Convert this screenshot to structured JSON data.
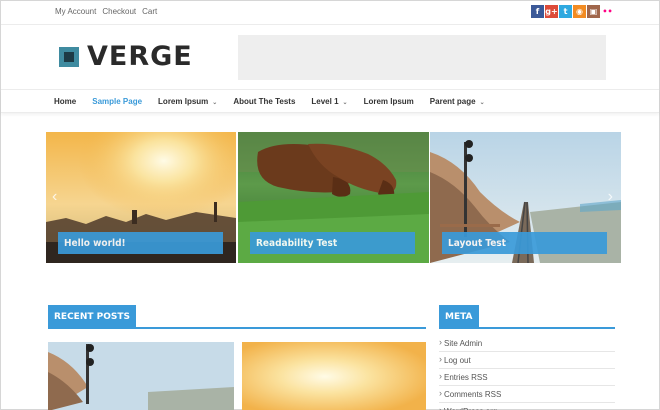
{
  "topbar": {
    "links": [
      "My Account",
      "Checkout",
      "Cart"
    ],
    "social": [
      {
        "name": "facebook-icon",
        "glyph": "f",
        "color": "#3b5998"
      },
      {
        "name": "googleplus-icon",
        "glyph": "g+",
        "color": "#dd4b39"
      },
      {
        "name": "twitter-icon",
        "glyph": "t",
        "color": "#2fa9e0"
      },
      {
        "name": "rss-icon",
        "glyph": "◉",
        "color": "#f28b22"
      },
      {
        "name": "instagram-icon",
        "glyph": "▣",
        "color": "#a0664b"
      },
      {
        "name": "flickr-icon",
        "glyph": "••",
        "color": "#ffffff"
      }
    ]
  },
  "logo": {
    "text": "VERGE"
  },
  "nav": {
    "items": [
      {
        "label": "Home",
        "active": false,
        "dropdown": false
      },
      {
        "label": "Sample Page",
        "active": true,
        "dropdown": false
      },
      {
        "label": "Lorem Ipsum",
        "active": false,
        "dropdown": true
      },
      {
        "label": "About The Tests",
        "active": false,
        "dropdown": false
      },
      {
        "label": "Level 1",
        "active": false,
        "dropdown": true
      },
      {
        "label": "Lorem Ipsum",
        "active": false,
        "dropdown": false
      },
      {
        "label": "Parent page",
        "active": false,
        "dropdown": true
      }
    ]
  },
  "slider": {
    "slides": [
      {
        "caption": "Hello world!",
        "scene": "sunset"
      },
      {
        "caption": "Readability Test",
        "scene": "dogs"
      },
      {
        "caption": "Layout Test",
        "scene": "railway"
      }
    ]
  },
  "recent_posts": {
    "title": "RECENT POSTS"
  },
  "meta": {
    "title": "META",
    "items": [
      "Site Admin",
      "Log out",
      "Entries RSS",
      "Comments RSS",
      "WordPress.org"
    ]
  },
  "colors": {
    "accent": "#3a9ad9"
  }
}
